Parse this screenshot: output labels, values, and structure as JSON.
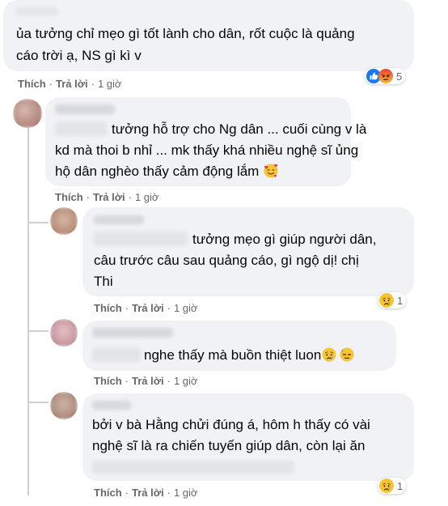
{
  "comments": [
    {
      "text_lines": [
        "ủa tưởng chỉ mẹo gì tốt lành cho dân, rốt cuộc là quảng",
        "cáo trời ạ, NS gì kì v"
      ],
      "like_label": "Thích",
      "reply_label": "Trả lời",
      "time": "1 giờ",
      "reactions": [
        "like",
        "angry"
      ],
      "reaction_count": "5"
    },
    {
      "text_lines": [
        "tưởng hỗ trợ cho Ng dân ... cuối cùng v là",
        "kd mà thoi b nhỉ ... mk thấy khá nhiều nghệ sĩ ủng",
        "hộ dân nghèo thấy cảm động lắm"
      ],
      "emoji": "smiling-face-with-hearts",
      "like_label": "Thích",
      "reply_label": "Trả lời",
      "time": "1 giờ"
    }
  ],
  "replies": [
    {
      "text_lines": [
        "tưởng mẹo gì giúp người dân,",
        "câu trước câu sau quảng cáo, gì ngộ dị! chị",
        "Thi"
      ],
      "like_label": "Thích",
      "reply_label": "Trả lời",
      "time": "1 giờ",
      "reactions": [
        "sad"
      ],
      "reaction_count": "1"
    },
    {
      "text_lines": [
        "nghe thấy mà buồn thiệt luon"
      ],
      "emojis": [
        "sad-face",
        "downcast-sweat-face"
      ],
      "like_label": "Thích",
      "reply_label": "Trả lời",
      "time": "1 giờ"
    },
    {
      "text_lines": [
        "bởi v bà Hằng chửi đúng á, hôm h thấy có vài",
        "nghệ sĩ là ra chiến tuyến giúp dân, còn lại ăn"
      ],
      "like_label": "Thích",
      "reply_label": "Trả lời",
      "time": "1 giờ",
      "reactions": [
        "sad"
      ],
      "reaction_count": "1"
    }
  ],
  "colors": {
    "bubble": "#f0f2f5",
    "meta_text": "#65676b",
    "like_blue": "#1877f2",
    "thread_line": "#ced0d4"
  }
}
